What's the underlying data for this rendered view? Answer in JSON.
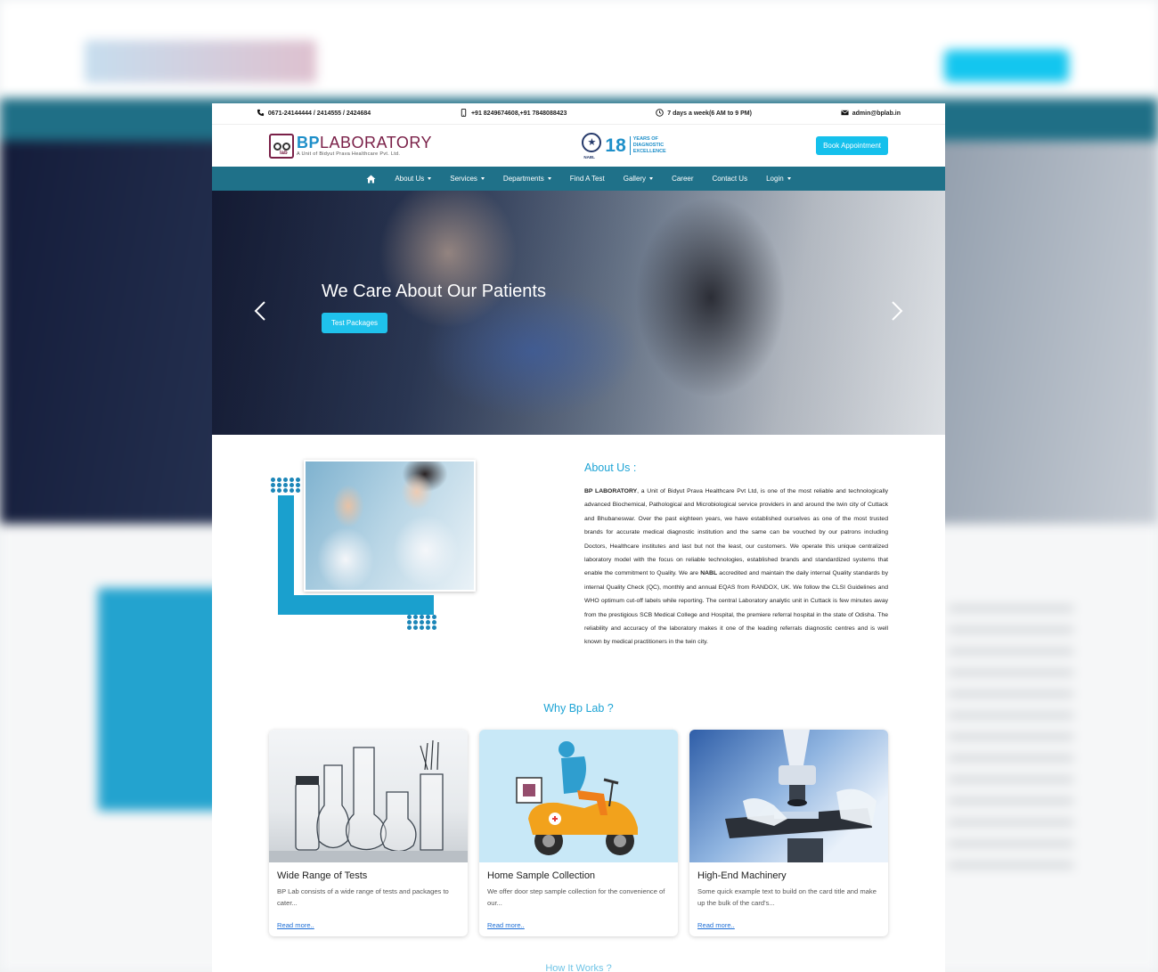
{
  "topbar": {
    "phone": "0671-24144444 / 2414555 / 2424684",
    "mobile": "+91 8249674608,+91 7848088423",
    "hours": "7 days a week(6 AM to 9 PM)",
    "email": "admin@bplab.in"
  },
  "header": {
    "logo_bp": "BP",
    "logo_lab": "LABORATORY",
    "logo_sub": "A Unit of Bidyut Prava Healthcare Pvt. Ltd.",
    "logo_mark_text": "lab",
    "nabl_label": "NABL",
    "nabl_years": "18",
    "nabl_line1": "YEARS OF",
    "nabl_line2": "DIAGNOSTIC",
    "nabl_line3": "EXCELLENCE",
    "book_button": "Book Appointment"
  },
  "nav": {
    "items": [
      {
        "label": "About Us",
        "dropdown": true
      },
      {
        "label": "Services",
        "dropdown": true
      },
      {
        "label": "Departments",
        "dropdown": true
      },
      {
        "label": "Find A Test",
        "dropdown": false
      },
      {
        "label": "Gallery",
        "dropdown": true
      },
      {
        "label": "Career",
        "dropdown": false
      },
      {
        "label": "Contact Us",
        "dropdown": false
      },
      {
        "label": "Login",
        "dropdown": true
      }
    ]
  },
  "hero": {
    "title": "We Care About Our Patients",
    "button": "Test Packages"
  },
  "about": {
    "title": "About Us :",
    "lead": "BP LABORATORY",
    "p1": ", a Unit of Bidyut Prava Healthcare Pvt Ltd, is one of the most reliable and technologically advanced Biochemical, Pathological and Microbiological service providers in and around the twin city of Cuttack and Bhubaneswar. Over the past eighteen years, we have established ourselves as one of the most trusted brands for accurate medical diagnostic institution and the same can be vouched by our patrons including Doctors, Healthcare institutes and last but not the least, our customers. We operate this unique centralized laboratory model with the focus on reliable technologies, established brands and standardized systems that enable the commitment to Quality. We are ",
    "nabl": "NABL",
    "p2": " accredited and maintain the daily internal Quality standards by internal Quality Check (QC), monthly and annual EQAS from RANDOX, UK. We follow the CLSI Guidelines and WHO optimum cut-off labels while reporting. The central Laboratory analytic unit in Cuttack is few minutes away from the prestigious SCB Medical College and Hospital, the premiere referral hospital in the state of Odisha. The reliability and accuracy of the laboratory makes it one of the leading referrals diagnostic centres and is well known by medical practitioners in the twin city."
  },
  "why": {
    "title": "Why Bp Lab ?",
    "cards": [
      {
        "title": "Wide Range of Tests",
        "text": "BP Lab consists of a wide range of tests and packages to cater...",
        "link": "Read more.."
      },
      {
        "title": "Home Sample Collection",
        "text": "We offer door step sample collection for the convenience of our...",
        "link": "Read more.."
      },
      {
        "title": "High-End Machinery",
        "text": "Some quick example text to build on the card title and make up the bulk of the card's...",
        "link": "Read more.."
      }
    ]
  },
  "how": {
    "title": "How It Works ?"
  },
  "colors": {
    "nav_bg": "#1f7189",
    "accent": "#1ea4d5",
    "button": "#15c0ec",
    "brand_maroon": "#7a2048"
  }
}
